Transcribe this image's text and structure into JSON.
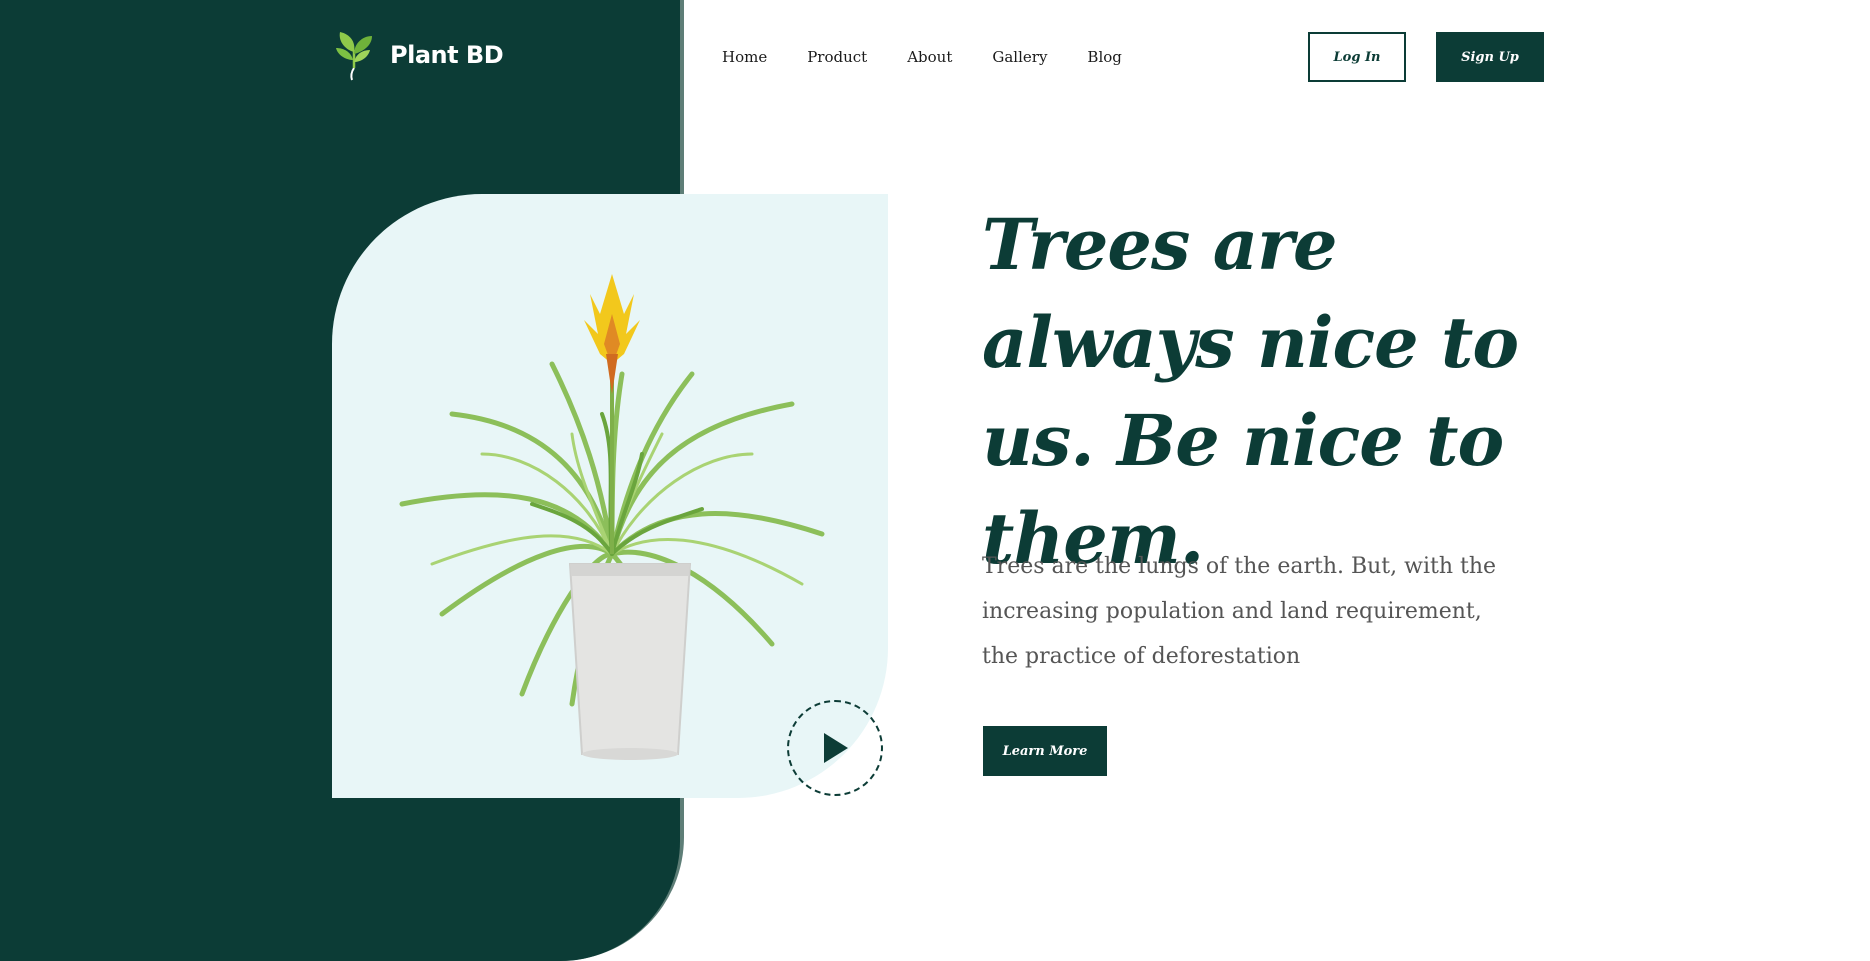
{
  "brand": {
    "name": "Plant BD",
    "icon": "leaf-sprout-icon"
  },
  "nav": {
    "items": [
      {
        "label": "Home"
      },
      {
        "label": "Product"
      },
      {
        "label": "About"
      },
      {
        "label": "Gallery"
      },
      {
        "label": "Blog"
      }
    ]
  },
  "auth": {
    "login_label": "Log In",
    "signup_label": "Sign Up"
  },
  "hero": {
    "title": "Trees are always nice to us. Be nice to them.",
    "description": "Trees are the lungs of the earth. But, with the increasing population and land requirement, the practice of deforestation",
    "cta_label": "Learn More",
    "play_icon": "play-icon",
    "image": "potted-plant-image"
  },
  "colors": {
    "primary": "#0c3c36",
    "card_background": "#e8f6f7",
    "accent_shadow": "#5e7e77",
    "body_text": "#555555"
  }
}
